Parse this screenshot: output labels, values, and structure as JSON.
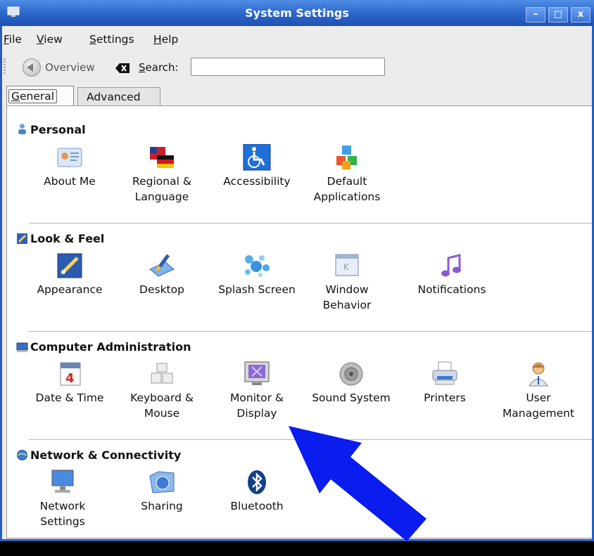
{
  "window": {
    "title": "System Settings",
    "controls": [
      "–",
      "□",
      "x"
    ]
  },
  "menu": {
    "file": "File",
    "view": "View",
    "settings": "Settings",
    "help": "Help"
  },
  "toolbar": {
    "overview": "Overview",
    "search_label": "Search:",
    "search_value": ""
  },
  "tabs": {
    "general": "General",
    "advanced": "Advanced"
  },
  "sections": {
    "personal": {
      "title": "Personal",
      "items": [
        {
          "label": "About Me",
          "icon": "id-card-icon"
        },
        {
          "label": "Regional &\nLanguage",
          "icon": "flags-icon"
        },
        {
          "label": "Accessibility",
          "icon": "wheelchair-icon"
        },
        {
          "label": "Default\nApplications",
          "icon": "cubes-icon"
        }
      ]
    },
    "look": {
      "title": "Look & Feel",
      "items": [
        {
          "label": "Appearance",
          "icon": "paint-icon"
        },
        {
          "label": "Desktop",
          "icon": "desktop-brush-icon"
        },
        {
          "label": "Splash Screen",
          "icon": "bubbles-icon"
        },
        {
          "label": "Window\nBehavior",
          "icon": "window-icon"
        },
        {
          "label": "Notifications",
          "icon": "music-note-icon"
        }
      ]
    },
    "admin": {
      "title": "Computer Administration",
      "items": [
        {
          "label": "Date & Time",
          "icon": "calendar-icon"
        },
        {
          "label": "Keyboard &\nMouse",
          "icon": "keyboard-icon"
        },
        {
          "label": "Monitor &\nDisplay",
          "icon": "monitor-icon"
        },
        {
          "label": "Sound System",
          "icon": "speaker-icon"
        },
        {
          "label": "Printers",
          "icon": "printer-icon"
        },
        {
          "label": "User\nManagement",
          "icon": "user-icon"
        }
      ]
    },
    "network": {
      "title": "Network & Connectivity",
      "items": [
        {
          "label": "Network\nSettings",
          "icon": "network-monitor-icon"
        },
        {
          "label": "Sharing",
          "icon": "sharing-folder-icon"
        },
        {
          "label": "Bluetooth",
          "icon": "bluetooth-icon"
        }
      ]
    }
  },
  "colors": {
    "titlebar": "#2b63c8",
    "annotation_arrow": "#0000ee"
  }
}
